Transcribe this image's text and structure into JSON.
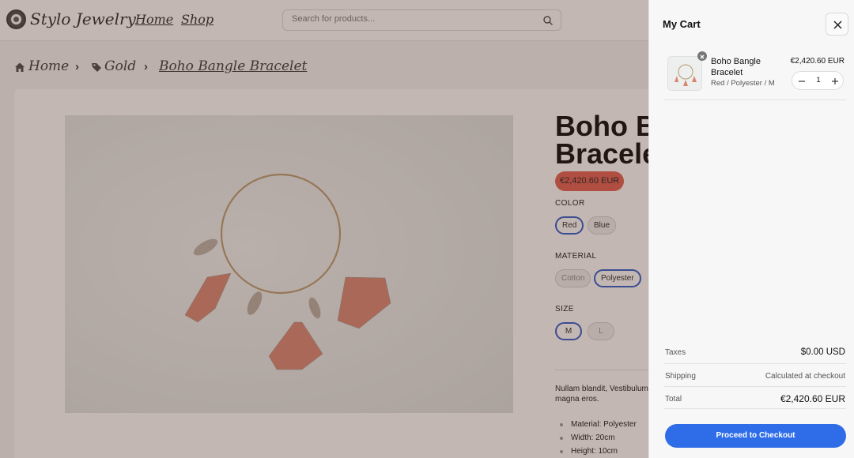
{
  "header": {
    "brand": "Stylo Jewelry",
    "nav": [
      "Home",
      "Shop"
    ],
    "search_placeholder": "Search for products..."
  },
  "breadcrumb": [
    "Home",
    "Gold",
    "Boho Bangle Bracelet"
  ],
  "product": {
    "title_line1": "Boho Ba",
    "title_line2": "Bracele",
    "price": "€2,420.60 EUR",
    "options": [
      {
        "label": "COLOR",
        "values": [
          "Red",
          "Blue"
        ],
        "selected": "Red"
      },
      {
        "label": "MATERIAL",
        "values": [
          "Cotton",
          "Polyester"
        ],
        "selected": "Polyester"
      },
      {
        "label": "SIZE",
        "values": [
          "M",
          "L"
        ],
        "selected": "M"
      }
    ],
    "description": "Nullam blandit, Vestibulum magna eros.",
    "specs": [
      "Material: Polyester",
      "Width: 20cm",
      "Height: 10cm"
    ]
  },
  "cart": {
    "title": "My Cart",
    "item": {
      "name": "Boho Bangle Bracelet",
      "variant": "Red / Polyester / M",
      "price": "€2,420.60 EUR",
      "quantity": "1"
    },
    "summary": {
      "taxes_label": "Taxes",
      "taxes_value": "$0.00 USD",
      "shipping_label": "Shipping",
      "shipping_value": "Calculated at checkout",
      "total_label": "Total",
      "total_value": "€2,420.60 EUR"
    },
    "checkout_label": "Proceed to Checkout"
  },
  "colors": {
    "accent": "#2f6de8",
    "price_badge": "#e25a4c",
    "selected_border": "#2b56c9"
  }
}
